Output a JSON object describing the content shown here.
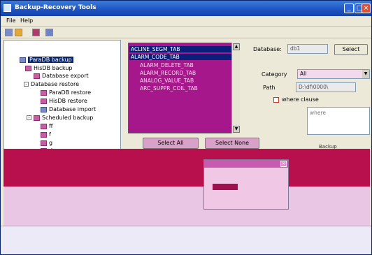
{
  "window": {
    "title": "Backup-Recovery Tools",
    "min": "_",
    "max": "□",
    "close": "×"
  },
  "menu": {
    "file": "File",
    "help": "Help"
  },
  "tree": {
    "nodes": [
      {
        "label": "ParaDB backup",
        "selected": true
      },
      {
        "label": "HisDB backup"
      },
      {
        "label": "Database export"
      },
      {
        "label": "Database restore"
      },
      {
        "label": "ParaDB restore"
      },
      {
        "label": "HisDB restore"
      },
      {
        "label": "Database import"
      },
      {
        "label": "Scheduled backup"
      },
      {
        "label": "ff"
      },
      {
        "label": "f"
      },
      {
        "label": "g"
      },
      {
        "label": "d"
      }
    ]
  },
  "tables": {
    "items": [
      "ACLINE_SEGM_TAB",
      "ALARM_CODE_TAB",
      "ALARM_DELETE_TAB",
      "ALARM_RECORD_TAB",
      "ANALOG_VALUE_TAB",
      "ARC_SUPPR_COIL_TAB"
    ],
    "select_all": "Select All",
    "select_none": "Select None"
  },
  "form": {
    "database_label": "Database:",
    "database_value": "db1",
    "select_button": "Select",
    "category_label": "Category",
    "category_value": "All",
    "path_label": "Path",
    "path_value": "D:\\df\\0000\\",
    "where_clause_label": "where clause",
    "where_placeholder": "where",
    "backup_label": "Backup"
  },
  "colors": {
    "titlebar": "#1d53c2",
    "selection": "#0a246a",
    "list_bg": "#a6178b",
    "band": "#b8104c"
  }
}
